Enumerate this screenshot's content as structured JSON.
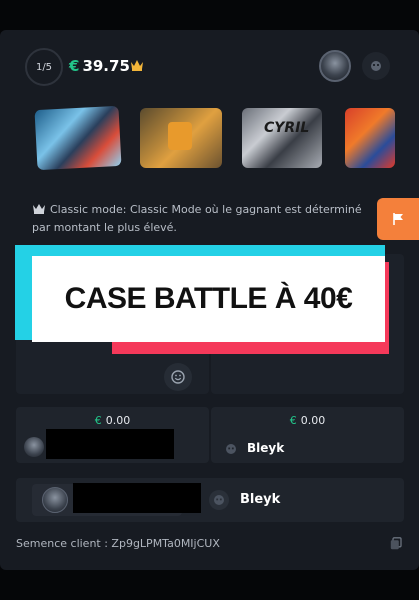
{
  "header": {
    "round": "1/5",
    "currency": "€",
    "total": "39.75"
  },
  "cases": [
    {
      "name": "",
      "icon": "case-blue-icon"
    },
    {
      "name": "",
      "icon": "case-gold-icon"
    },
    {
      "name": "CYRIL",
      "icon": "case-grey-icon"
    },
    {
      "name": "",
      "icon": "case-red-icon"
    }
  ],
  "mode": {
    "text": "Classic mode: Classic Mode où le gagnant est déterminé par montant le plus élevé."
  },
  "banner": {
    "text": "CASE BATTLE À 40€"
  },
  "players": [
    {
      "currency": "€",
      "amount": "0.00",
      "name": ""
    },
    {
      "currency": "€",
      "amount": "0.00",
      "name": "Bleyk"
    }
  ],
  "winner_row": {
    "bot_name": "Bleyk"
  },
  "seed": {
    "label": "Semence client : Zp9gLPMTa0MIjCUX"
  },
  "colors": {
    "panel": "#171b22",
    "accent_green": "#23c58a",
    "flag_orange": "#f4803b",
    "banner_cyan": "#24d1e6",
    "banner_red": "#f5395a",
    "crown_gold": "#f2b53a"
  }
}
